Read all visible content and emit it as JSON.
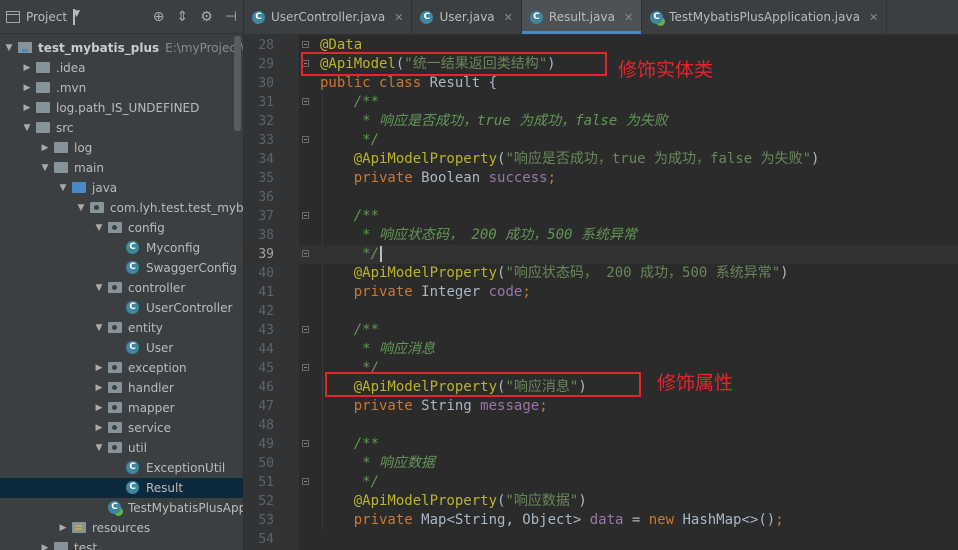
{
  "project": {
    "title": "Project",
    "tree": [
      {
        "label": "test_mybatis_plus",
        "path": "E:\\myProject\\tes",
        "depth": 0,
        "arrow": "open",
        "icon": "module",
        "bold": true
      },
      {
        "label": ".idea",
        "depth": 1,
        "arrow": "closed",
        "icon": "folder"
      },
      {
        "label": ".mvn",
        "depth": 1,
        "arrow": "closed",
        "icon": "folder"
      },
      {
        "label": "log.path_IS_UNDEFINED",
        "depth": 1,
        "arrow": "closed",
        "icon": "folder"
      },
      {
        "label": "src",
        "depth": 1,
        "arrow": "open",
        "icon": "folder"
      },
      {
        "label": "log",
        "depth": 2,
        "arrow": "closed",
        "icon": "folder"
      },
      {
        "label": "main",
        "depth": 2,
        "arrow": "open",
        "icon": "folder"
      },
      {
        "label": "java",
        "depth": 3,
        "arrow": "open",
        "icon": "src"
      },
      {
        "label": "com.lyh.test.test_mybati",
        "depth": 4,
        "arrow": "open",
        "icon": "pkg"
      },
      {
        "label": "config",
        "depth": 5,
        "arrow": "open",
        "icon": "pkg"
      },
      {
        "label": "Myconfig",
        "depth": 6,
        "arrow": "none",
        "icon": "class"
      },
      {
        "label": "SwaggerConfig",
        "depth": 6,
        "arrow": "none",
        "icon": "class"
      },
      {
        "label": "controller",
        "depth": 5,
        "arrow": "open",
        "icon": "pkg"
      },
      {
        "label": "UserController",
        "depth": 6,
        "arrow": "none",
        "icon": "class"
      },
      {
        "label": "entity",
        "depth": 5,
        "arrow": "open",
        "icon": "pkg"
      },
      {
        "label": "User",
        "depth": 6,
        "arrow": "none",
        "icon": "class"
      },
      {
        "label": "exception",
        "depth": 5,
        "arrow": "closed",
        "icon": "pkg"
      },
      {
        "label": "handler",
        "depth": 5,
        "arrow": "closed",
        "icon": "pkg"
      },
      {
        "label": "mapper",
        "depth": 5,
        "arrow": "closed",
        "icon": "pkg"
      },
      {
        "label": "service",
        "depth": 5,
        "arrow": "closed",
        "icon": "pkg"
      },
      {
        "label": "util",
        "depth": 5,
        "arrow": "open",
        "icon": "pkg"
      },
      {
        "label": "ExceptionUtil",
        "depth": 6,
        "arrow": "none",
        "icon": "class"
      },
      {
        "label": "Result",
        "depth": 6,
        "arrow": "none",
        "icon": "class",
        "selected": true
      },
      {
        "label": "TestMybatisPlusAppl",
        "depth": 5,
        "arrow": "none",
        "icon": "app"
      },
      {
        "label": "resources",
        "depth": 3,
        "arrow": "closed",
        "icon": "res"
      },
      {
        "label": "test",
        "depth": 2,
        "arrow": "closed",
        "icon": "folder"
      }
    ]
  },
  "tabs": [
    {
      "label": "UserController.java",
      "icon": "class",
      "active": false
    },
    {
      "label": "User.java",
      "icon": "class",
      "active": false
    },
    {
      "label": "Result.java",
      "icon": "class",
      "active": true
    },
    {
      "label": "TestMybatisPlusApplication.java",
      "icon": "app",
      "active": false
    }
  ],
  "editor": {
    "current_line": 39,
    "lines": [
      {
        "n": "28",
        "fold": true,
        "tokens": [
          [
            "ann",
            "@Data"
          ]
        ]
      },
      {
        "n": "29",
        "fold": true,
        "tokens": [
          [
            "ann",
            "@ApiModel"
          ],
          [
            "plain",
            "("
          ],
          [
            "str",
            "\"统一结果返回类结构\""
          ],
          [
            "plain",
            ")"
          ]
        ]
      },
      {
        "n": "30",
        "tokens": [
          [
            "kw",
            "public class "
          ],
          [
            "plain",
            "Result {"
          ]
        ]
      },
      {
        "n": "31",
        "fold": true,
        "tokens": [
          [
            "doc",
            "    /**"
          ]
        ]
      },
      {
        "n": "32",
        "tokens": [
          [
            "doc",
            "     * 响应是否成功，true 为成功，false 为失败"
          ]
        ]
      },
      {
        "n": "33",
        "fold": true,
        "tokens": [
          [
            "doc",
            "     */"
          ]
        ]
      },
      {
        "n": "34",
        "tokens": [
          [
            "ann",
            "    @ApiModelProperty"
          ],
          [
            "plain",
            "("
          ],
          [
            "str",
            "\"响应是否成功，true 为成功，false 为失败\""
          ],
          [
            "plain",
            ")"
          ]
        ]
      },
      {
        "n": "35",
        "tokens": [
          [
            "kw",
            "    private "
          ],
          [
            "plain",
            "Boolean "
          ],
          [
            "fld",
            "success"
          ],
          [
            "kw",
            ";"
          ]
        ]
      },
      {
        "n": "36",
        "tokens": []
      },
      {
        "n": "37",
        "fold": true,
        "tokens": [
          [
            "doc",
            "    /**"
          ]
        ]
      },
      {
        "n": "38",
        "tokens": [
          [
            "doc",
            "     * 响应状态码， 200 成功，500 系统异常"
          ]
        ]
      },
      {
        "n": "39",
        "fold": true,
        "tokens": [
          [
            "doc",
            "     */"
          ]
        ],
        "caret": true
      },
      {
        "n": "40",
        "tokens": [
          [
            "ann",
            "    @ApiModelProperty"
          ],
          [
            "plain",
            "("
          ],
          [
            "str",
            "\"响应状态码， 200 成功，500 系统异常\""
          ],
          [
            "plain",
            ")"
          ]
        ]
      },
      {
        "n": "41",
        "tokens": [
          [
            "kw",
            "    private "
          ],
          [
            "plain",
            "Integer "
          ],
          [
            "fld",
            "code"
          ],
          [
            "kw",
            ";"
          ]
        ]
      },
      {
        "n": "42",
        "tokens": []
      },
      {
        "n": "43",
        "fold": true,
        "tokens": [
          [
            "doc",
            "    /**"
          ]
        ]
      },
      {
        "n": "44",
        "tokens": [
          [
            "doc",
            "     * 响应消息"
          ]
        ]
      },
      {
        "n": "45",
        "fold": true,
        "tokens": [
          [
            "doc",
            "     */"
          ]
        ]
      },
      {
        "n": "46",
        "tokens": [
          [
            "ann",
            "    @ApiModelProperty"
          ],
          [
            "plain",
            "("
          ],
          [
            "str",
            "\"响应消息\""
          ],
          [
            "plain",
            ")"
          ]
        ]
      },
      {
        "n": "47",
        "tokens": [
          [
            "kw",
            "    private "
          ],
          [
            "plain",
            "String "
          ],
          [
            "fld",
            "message"
          ],
          [
            "kw",
            ";"
          ]
        ]
      },
      {
        "n": "48",
        "tokens": []
      },
      {
        "n": "49",
        "fold": true,
        "tokens": [
          [
            "doc",
            "    /**"
          ]
        ]
      },
      {
        "n": "50",
        "tokens": [
          [
            "doc",
            "     * 响应数据"
          ]
        ]
      },
      {
        "n": "51",
        "fold": true,
        "tokens": [
          [
            "doc",
            "     */"
          ]
        ]
      },
      {
        "n": "52",
        "tokens": [
          [
            "ann",
            "    @ApiModelProperty"
          ],
          [
            "plain",
            "("
          ],
          [
            "str",
            "\"响应数据\""
          ],
          [
            "plain",
            ")"
          ]
        ]
      },
      {
        "n": "53",
        "tokens": [
          [
            "kw",
            "    private "
          ],
          [
            "plain",
            "Map<String, Object> "
          ],
          [
            "fld",
            "data"
          ],
          [
            "plain",
            " = "
          ],
          [
            "kw",
            "new "
          ],
          [
            "plain",
            "HashMap<>()"
          ],
          [
            "kw",
            ";"
          ]
        ]
      },
      {
        "n": "54",
        "tokens": []
      }
    ]
  },
  "annotations": {
    "entity_note": "修饰实体类",
    "property_note": "修饰属性",
    "color": "#e8242b"
  }
}
